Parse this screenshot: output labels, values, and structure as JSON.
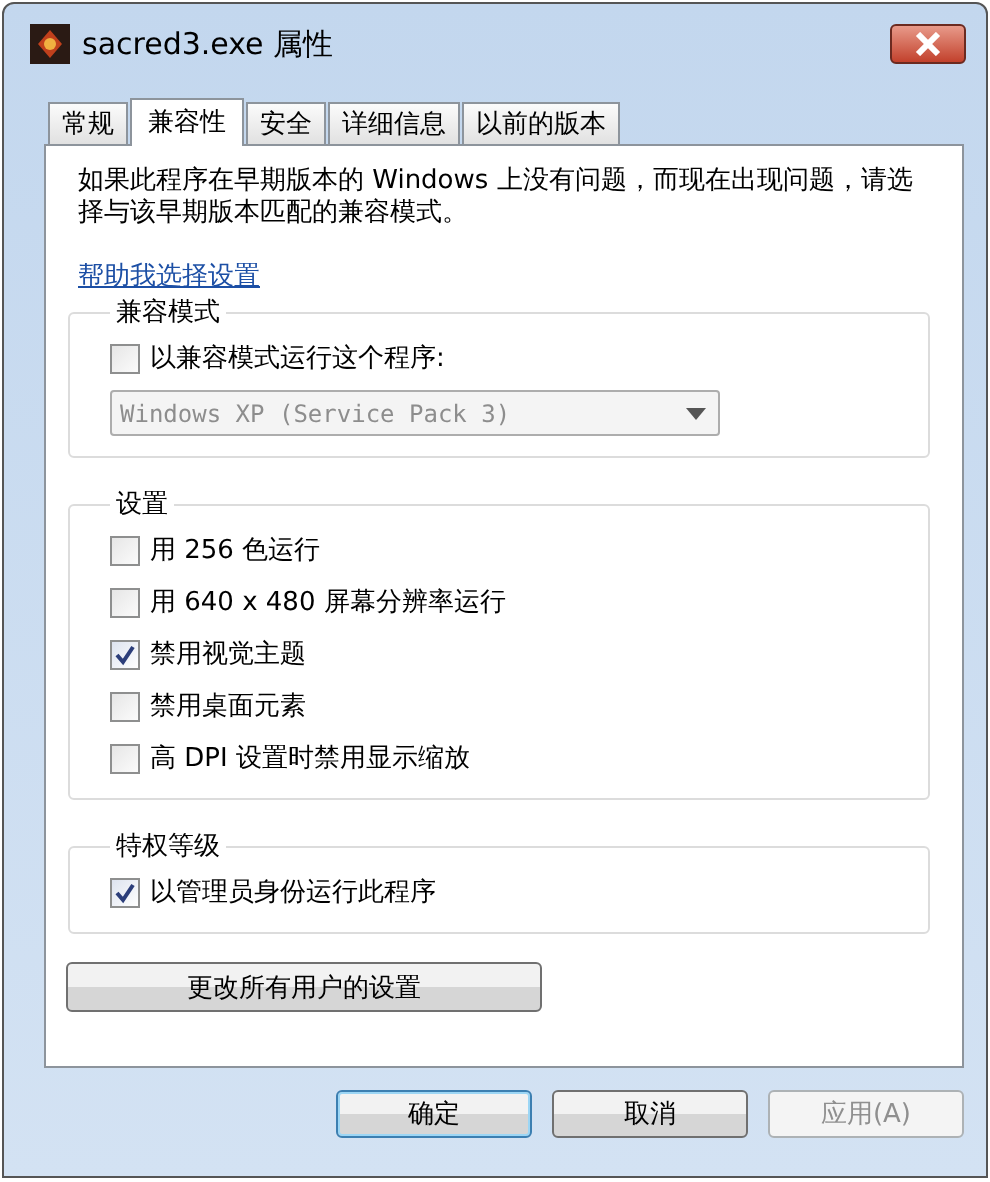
{
  "window": {
    "title": "sacred3.exe 属性"
  },
  "tabs": [
    {
      "label": "常规",
      "selected": false
    },
    {
      "label": "兼容性",
      "selected": true
    },
    {
      "label": "安全",
      "selected": false
    },
    {
      "label": "详细信息",
      "selected": false
    },
    {
      "label": "以前的版本",
      "selected": false
    }
  ],
  "description": "如果此程序在早期版本的 Windows 上没有问题，而现在出现问题，请选择与该早期版本匹配的兼容模式。",
  "help_link": "帮助我选择设置",
  "groups": [
    {
      "title": "兼容模式",
      "items": [
        {
          "kind": "checkbox",
          "label": "以兼容模式运行这个程序:",
          "checked": false
        },
        {
          "kind": "dropdown",
          "value": "Windows XP (Service Pack 3)",
          "disabled": true
        }
      ]
    },
    {
      "title": "设置",
      "items": [
        {
          "kind": "checkbox",
          "label": "用 256 色运行",
          "checked": false
        },
        {
          "kind": "checkbox",
          "label": "用 640 x 480 屏幕分辨率运行",
          "checked": false
        },
        {
          "kind": "checkbox",
          "label": "禁用视觉主题",
          "checked": true
        },
        {
          "kind": "checkbox",
          "label": "禁用桌面元素",
          "checked": false
        },
        {
          "kind": "checkbox",
          "label": "高 DPI 设置时禁用显示缩放",
          "checked": false
        }
      ]
    },
    {
      "title": "特权等级",
      "items": [
        {
          "kind": "checkbox",
          "label": "以管理员身份运行此程序",
          "checked": true
        }
      ]
    }
  ],
  "all_users_button": "更改所有用户的设置",
  "buttons": [
    {
      "label": "确定",
      "default": true,
      "disabled": false
    },
    {
      "label": "取消",
      "default": false,
      "disabled": false
    },
    {
      "label": "应用(A)",
      "default": false,
      "disabled": true
    }
  ]
}
